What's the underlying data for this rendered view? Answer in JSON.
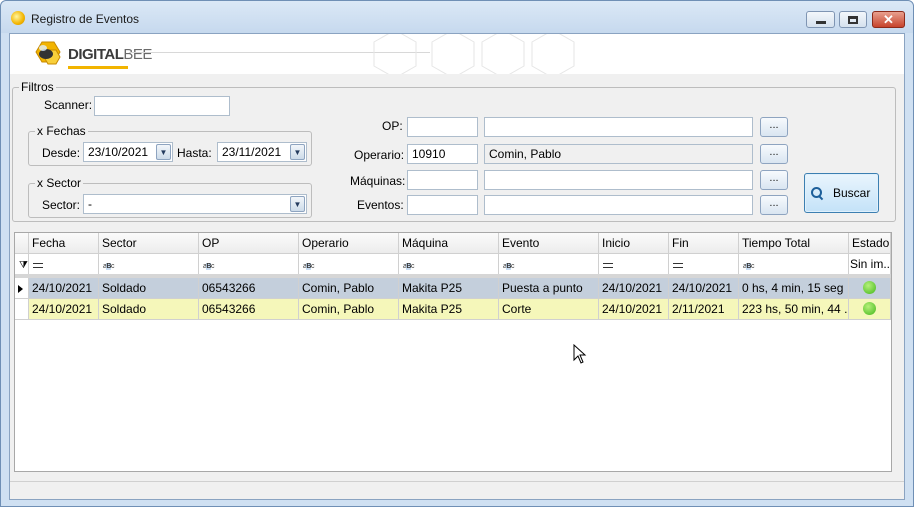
{
  "window": {
    "title": "Registro de Eventos"
  },
  "brand": {
    "name_bold": "DIGITAL",
    "name_light": "BEE"
  },
  "filters": {
    "legend": "Filtros",
    "scanner_label": "Scanner:",
    "scanner_value": "",
    "fechas": {
      "legend": "x Fechas",
      "desde_label": "Desde:",
      "desde_value": "23/10/2021",
      "hasta_label": "Hasta:",
      "hasta_value": "23/11/2021"
    },
    "sector": {
      "legend": "x Sector",
      "sector_label": "Sector:",
      "sector_value": "-"
    },
    "op_label": "OP:",
    "op_code": "",
    "op_desc": "",
    "operario_label": "Operario:",
    "operario_code": "10910",
    "operario_desc": "Comin, Pablo",
    "maquinas_label": "Máquinas:",
    "maquinas_code": "",
    "maquinas_desc": "",
    "eventos_label": "Eventos:",
    "eventos_code": "",
    "eventos_desc": "",
    "ellipsis_label": "...",
    "buscar_label": "Buscar"
  },
  "grid": {
    "columns": [
      "Fecha",
      "Sector",
      "OP",
      "Operario",
      "Máquina",
      "Evento",
      "Inicio",
      "Fin",
      "Tiempo Total",
      "Estado"
    ],
    "filter_row": [
      "=",
      "abc",
      "abc",
      "abc",
      "abc",
      "abc",
      "=",
      "=",
      "abc",
      "Sin im..."
    ],
    "rows": [
      [
        "24/10/2021",
        "Soldado",
        "06543266",
        "Comin, Pablo",
        "Makita P25",
        "Puesta a punto",
        "24/10/2021",
        "24/10/2021",
        "0 hs, 4 min, 15 seg",
        "smile-ok"
      ],
      [
        "24/10/2021",
        "Soldado",
        "06543266",
        "Comin, Pablo",
        "Makita P25",
        "Corte",
        "24/10/2021",
        "2/11/2021",
        "223 hs, 50 min, 44 ...",
        "smile-ok"
      ]
    ]
  },
  "colors": {
    "selected_row": "#c4cfdc",
    "highlight_row": "#f5f7ba",
    "status_ok": "#41b71a",
    "accent": "#f2b400"
  }
}
